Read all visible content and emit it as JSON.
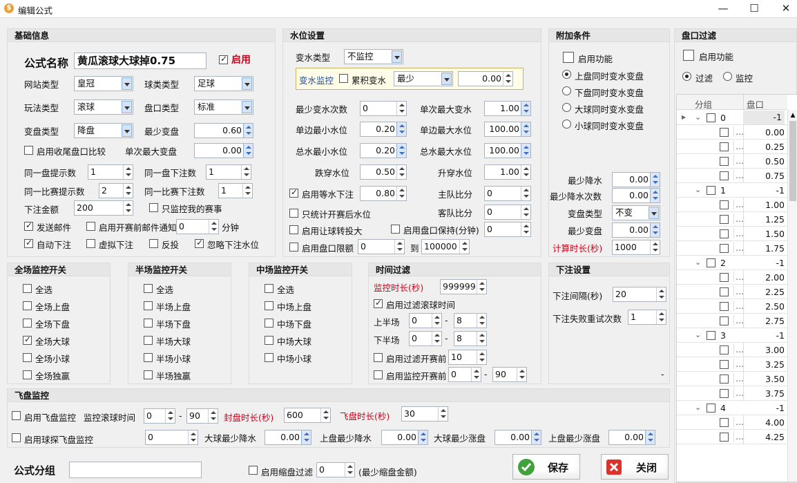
{
  "window": {
    "title": "编辑公式",
    "app_icon": "dollar-icon",
    "minimize": "—",
    "maximize": "☐",
    "close": "✕"
  },
  "basic": {
    "header": "基础信息",
    "formula_name_label": "公式名称",
    "formula_name": "黄瓜滚球大球掉0.75",
    "enable_label": "启用",
    "site_type_label": "网站类型",
    "site_type": "皇冠",
    "ball_type_label": "球类类型",
    "ball_type": "足球",
    "play_type_label": "玩法类型",
    "play_type": "滚球",
    "handicap_type_label": "盘口类型",
    "handicap_type": "标准",
    "change_type_label": "变盘类型",
    "change_type": "降盘",
    "min_change_label": "最少变盘",
    "min_change": "0.60",
    "close_compare_label": "启用收尾盘口比较",
    "max_single_change_label": "单次最大变盘",
    "max_single_change": "0.00",
    "same_tip_label": "同一盘提示数",
    "same_tip": "1",
    "same_bet_label": "同一盘下注数",
    "same_bet": "1",
    "match_tip_label": "同一比赛提示数",
    "match_tip": "2",
    "match_bet_label": "同一比赛下注数",
    "match_bet": "1",
    "amount_label": "下注金额",
    "amount": "200",
    "only_my_label": "只监控我的赛事",
    "send_mail_label": "发送邮件",
    "pre_mail_label": "启用开赛前邮件通知",
    "pre_mail_val": "0",
    "minute_label": "分钟",
    "auto_bet_label": "自动下注",
    "virtual_bet_label": "虚拟下注",
    "reverse_label": "反投",
    "ignore_water_label": "忽略下注水位"
  },
  "water": {
    "header": "水位设置",
    "change_type_label": "变水类型",
    "change_type": "不监控",
    "monitor_label": "变水监控",
    "accum_label": "累积变水",
    "accum_mode": "最少",
    "accum_val": "0.00",
    "min_count_label": "最少变水次数",
    "min_count": "0",
    "max_single_label": "单次最大变水",
    "max_single": "1.00",
    "side_min_label": "单边最小水位",
    "side_min": "0.20",
    "side_max_label": "单边最大水位",
    "side_max": "100.00",
    "total_min_label": "总水最小水位",
    "total_min": "0.20",
    "total_max_label": "总水最大水位",
    "total_max": "100.00",
    "fall_label": "跌穿水位",
    "fall": "0.50",
    "rise_label": "升穿水位",
    "rise": "1.00",
    "equal_label": "启用等水下注",
    "equal": "0.80",
    "home_label": "主队比分",
    "home": "0",
    "only_stats_label": "只统计开赛后水位",
    "away_label": "客队比分",
    "away": "0",
    "let_label": "启用让球转投大",
    "keep_label": "启用盘口保持(分钟)",
    "keep": "0",
    "limit_label": "启用盘口限额",
    "limit_from": "0",
    "to_label": "到",
    "limit_to": "100000"
  },
  "extra": {
    "header": "附加条件",
    "enable_label": "启用功能",
    "opt1": "上盘同时变水变盘",
    "opt2": "下盘同时变水变盘",
    "opt3": "大球同时变水变盘",
    "opt4": "小球同时变水变盘",
    "min_drop_label": "最少降水",
    "min_drop": "0.00",
    "min_drop_count_label": "最少降水次数",
    "min_drop_count": "0.00",
    "change_type_label": "变盘类型",
    "change_type": "不变",
    "min_change_label": "最少变盘",
    "min_change": "0.00",
    "calc_label": "计算时长(秒)",
    "calc": "1000"
  },
  "filter": {
    "header": "盘口过滤",
    "enable_label": "启用功能",
    "filter_label": "过滤",
    "monitor_label": "监控",
    "col_group": "分组",
    "col_handicap": "盘口",
    "groups": [
      {
        "name": "0",
        "val": "-1",
        "items": [
          "0.00",
          "0.25",
          "0.50",
          "0.75"
        ]
      },
      {
        "name": "1",
        "val": "-1",
        "items": [
          "1.00",
          "1.25",
          "1.50",
          "1.75"
        ]
      },
      {
        "name": "2",
        "val": "-1",
        "items": [
          "2.00",
          "2.25",
          "2.50",
          "2.75"
        ]
      },
      {
        "name": "3",
        "val": "-1",
        "items": [
          "3.00",
          "3.25",
          "3.50",
          "3.75"
        ]
      },
      {
        "name": "4",
        "val": "-1",
        "items": [
          "4.00",
          "4.25"
        ]
      }
    ],
    "ellipsis": "..."
  },
  "full": {
    "header": "全场监控开关",
    "items": [
      "全选",
      "全场上盘",
      "全场下盘",
      "全场大球",
      "全场小球",
      "全场独赢"
    ]
  },
  "half": {
    "header": "半场监控开关",
    "items": [
      "全选",
      "半场上盘",
      "半场下盘",
      "半场大球",
      "半场小球",
      "半场独赢"
    ]
  },
  "mid": {
    "header": "中场监控开关",
    "items": [
      "全选",
      "中场上盘",
      "中场下盘",
      "中场大球",
      "中场小球"
    ]
  },
  "time": {
    "header": "时间过滤",
    "duration_label": "监控时长(秒)",
    "duration": "999999",
    "roll_label": "启用过滤滚球时间",
    "first_label": "上半场",
    "first_from": "0",
    "first_to": "8",
    "second_label": "下半场",
    "second_from": "0",
    "second_to": "8",
    "dash": "-",
    "pre_label": "启用过滤开赛前",
    "pre": "10",
    "pre_mon_label": "启用监控开赛前",
    "pre_mon_from": "0",
    "pre_mon_to": "90"
  },
  "bet": {
    "header": "下注设置",
    "interval_label": "下注间隔(秒)",
    "interval": "20",
    "retry_label": "下注失败重试次数",
    "retry": "1",
    "dash": "-"
  },
  "fly": {
    "header": "飞盘监控",
    "enable_label": "启用飞盘监控",
    "roll_time_label": "监控滚球时间",
    "roll_from": "0",
    "roll_to": "90",
    "seal_label": "封盘时长(秒)",
    "seal": "600",
    "fly_label": "飞盘时长(秒)",
    "fly": "30",
    "probe_label": "启用球探飞盘监控",
    "probe": "0",
    "big_drop_label": "大球最少降水",
    "big_drop": "0.00",
    "up_drop_label": "上盘最少降水",
    "up_drop": "0.00",
    "big_rise_label": "大球最少涨盘",
    "big_rise": "0.00",
    "up_rise_label": "上盘最少涨盘",
    "up_rise": "0.00"
  },
  "footer": {
    "group_label": "公式分组",
    "group": "",
    "shrink_label": "启用缩盘过滤",
    "shrink": "0",
    "shrink_note": "(最少缩盘金额)",
    "save": "保存",
    "close": "关闭"
  }
}
